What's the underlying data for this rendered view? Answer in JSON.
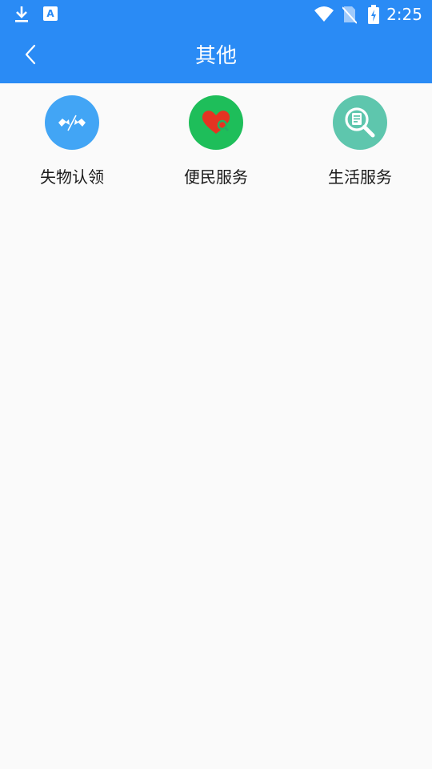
{
  "status_bar": {
    "time": "2:25",
    "icons": [
      "download-icon",
      "text-input-icon",
      "wifi-icon",
      "no-sim-icon",
      "battery-charging-icon"
    ]
  },
  "header": {
    "title": "其他",
    "back_icon": "chevron-left-icon",
    "background_color": "#2a8bf5"
  },
  "grid": {
    "items": [
      {
        "label": "失物认领",
        "icon": "flags-icon",
        "color": "#42a5f5"
      },
      {
        "label": "便民服务",
        "icon": "heart-search-icon",
        "color": "#1ebe5a"
      },
      {
        "label": "生活服务",
        "icon": "document-search-icon",
        "color": "#5ec6ad"
      }
    ]
  }
}
